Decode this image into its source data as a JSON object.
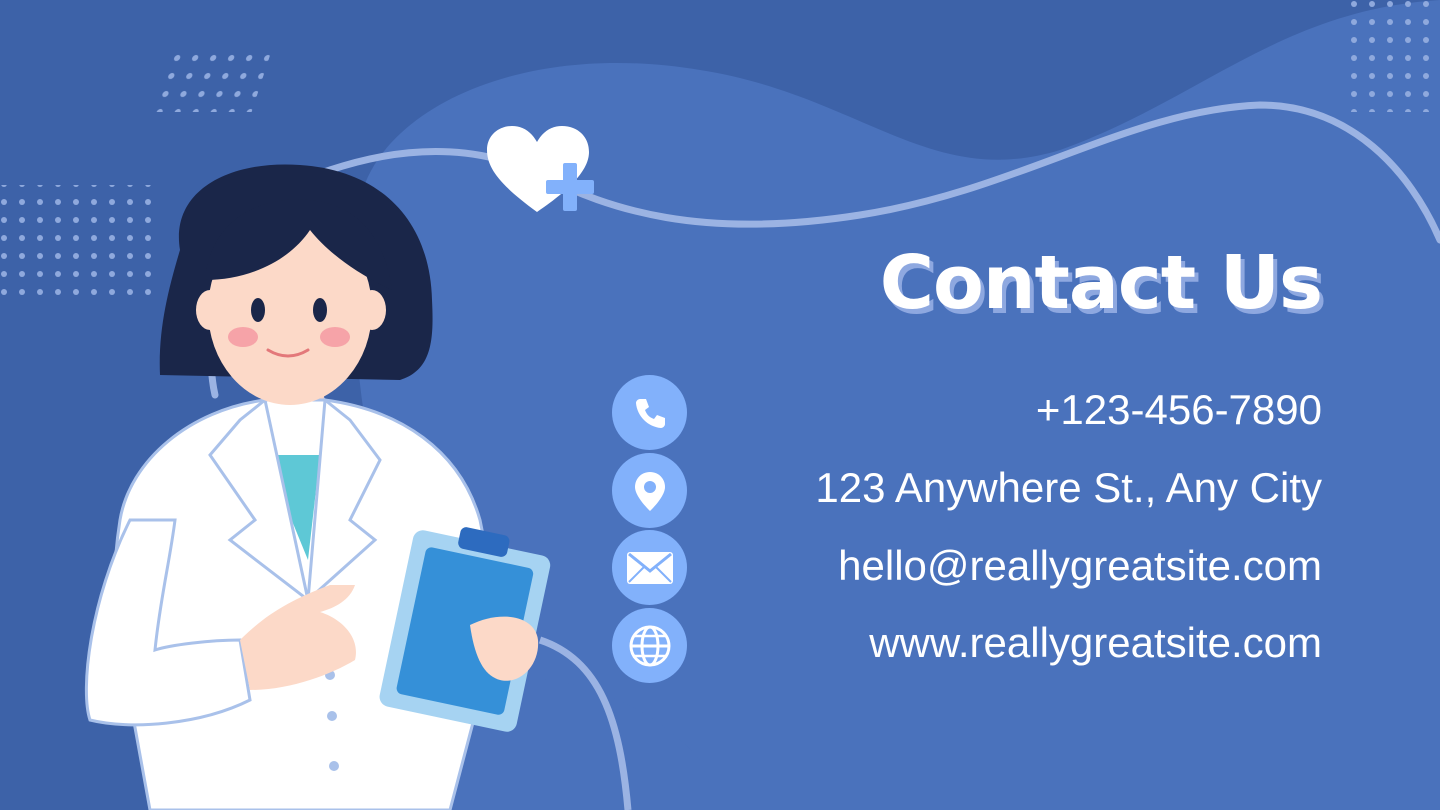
{
  "title": "Contact Us",
  "contacts": {
    "phone": {
      "icon": "phone-icon",
      "text": "+123-456-7890"
    },
    "address": {
      "icon": "location-pin-icon",
      "text": "123 Anywhere St., Any City"
    },
    "email": {
      "icon": "envelope-icon",
      "text": "hello@reallygreatsite.com"
    },
    "website": {
      "icon": "globe-icon",
      "text": "www.reallygreatsite.com"
    }
  },
  "colors": {
    "background": "#3d62a8",
    "blob": "#4a72bc",
    "icon_circle": "#82b1fb",
    "text": "#ffffff",
    "title_shadow": "#8ea8e0"
  },
  "illustration": {
    "subject": "doctor-with-clipboard",
    "accent_icon": "heart-plus-icon"
  }
}
